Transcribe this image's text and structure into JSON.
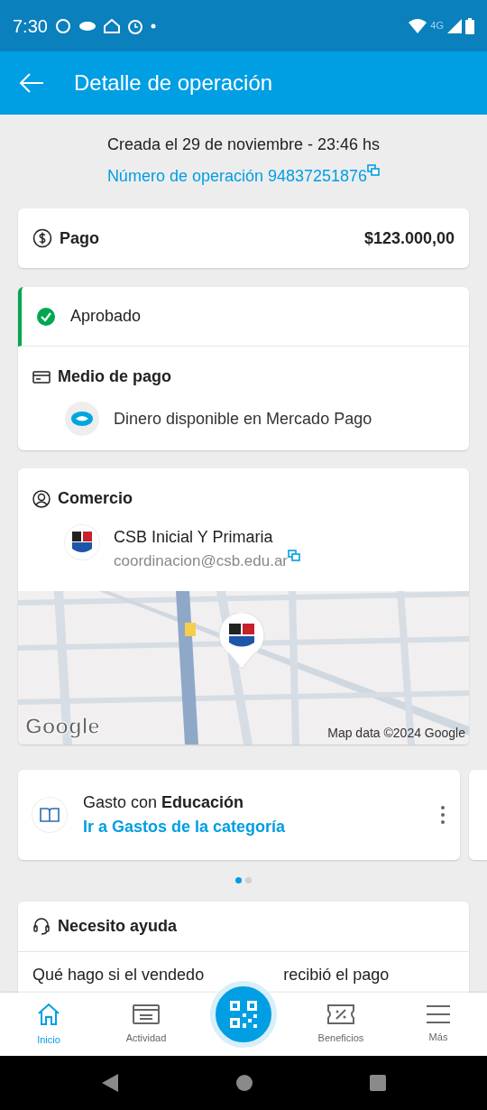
{
  "status_bar": {
    "time": "7:30",
    "network": "4G"
  },
  "app_bar": {
    "title": "Detalle de operación"
  },
  "created": "Creada el 29 de noviembre - 23:46 hs",
  "operation_number": "Número de operación 94837251876",
  "payment": {
    "label": "Pago",
    "amount": "$123.000,00"
  },
  "status": {
    "label": "Aprobado",
    "approved": true
  },
  "payment_method": {
    "title": "Medio de pago",
    "method": "Dinero disponible en Mercado Pago"
  },
  "merchant": {
    "title": "Comercio",
    "name": "CSB Inicial Y Primaria",
    "email": "coordinacion@csb.edu.ar",
    "map": {
      "logo": "Google",
      "attribution": "Map data ©2024 Google"
    }
  },
  "category_card": {
    "text": "Gasto con **Educación**",
    "link": "Ir a Gastos de la categoría"
  },
  "carousel": {
    "pages": [
      {
        "selected": true
      },
      {
        "selected": false
      }
    ]
  },
  "help": {
    "title": "Necesito ayuda",
    "question_parts": [
      "Qué hago si el vendedo",
      "recibió el pago"
    ]
  },
  "bottom_nav": [
    {
      "kind": "home",
      "label": "Inicio",
      "selected": true
    },
    {
      "kind": "activity",
      "label": "Actividad",
      "selected": false
    },
    {
      "kind": "qr",
      "selected": false
    },
    {
      "kind": "benefits",
      "label": "Beneficios",
      "selected": false
    },
    {
      "kind": "menu",
      "label": "Más",
      "selected": false
    }
  ]
}
